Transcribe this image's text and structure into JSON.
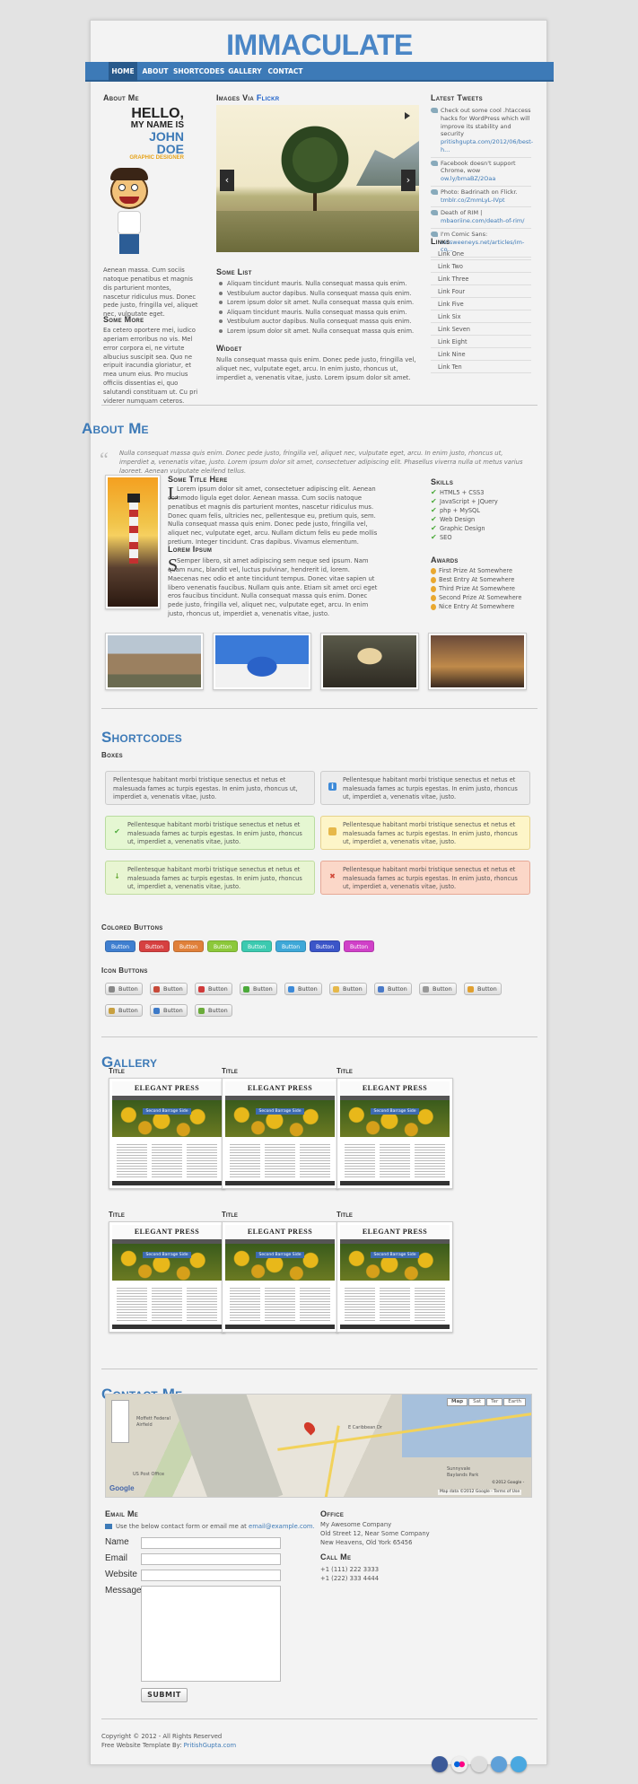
{
  "site": {
    "logo": "IMMACULATE"
  },
  "nav": {
    "items": [
      "HOME",
      "ABOUT",
      "SHORTCODES",
      "GALLERY",
      "CONTACT"
    ]
  },
  "about_widget": {
    "title": "About Me",
    "badge_hello": "HELLO,",
    "badge_my_name": "MY NAME IS",
    "badge_name": "JOHN DOE",
    "badge_role": "GRAPHIC DESIGNER",
    "text1": "Aenean massa. Cum sociis natoque penatibus et magnis dis parturient montes, nascetur ridiculus mus. Donec pede justo, fringilla vel, aliquet nec, vulputate eget.",
    "more_title": "Some More",
    "text2": "Ea cetero oportere mei, iudico aperiam erroribus no vis. Mel error corpora ei, ne virtute albucius suscipit sea. Quo ne eripuit iracundia gloriatur, et mea unum eius. Pro mucius officiis dissentias ei, quo salutandi constituam ut. Cu pri viderer numquam ceteros."
  },
  "flickr": {
    "title_prefix": "Images Via ",
    "title_brand": "Flickr",
    "prev_icon": "chevron-left-icon",
    "next_icon": "chevron-right-icon"
  },
  "some_list": {
    "title": "Some List",
    "items": [
      "Aliquam tincidunt mauris. Nulla consequat massa quis enim.",
      "Vestibulum auctor dapibus. Nulla consequat massa quis enim.",
      "Lorem ipsum dolor sit amet. Nulla consequat massa quis enim.",
      "Aliquam tincidunt mauris. Nulla consequat massa quis enim.",
      "Vestibulum auctor dapibus. Nulla consequat massa quis enim.",
      "Lorem ipsum dolor sit amet. Nulla consequat massa quis enim."
    ]
  },
  "widget": {
    "title": "Widget",
    "text": "Nulla consequat massa quis enim. Donec pede justo, fringilla vel, aliquet nec, vulputate eget, arcu. In enim justo, rhoncus ut, imperdiet a, venenatis vitae, justo. Lorem ipsum dolor sit amet."
  },
  "tweets": {
    "title": "Latest Tweets",
    "items": [
      {
        "text": "Check out some cool .htaccess hacks for WordPress which will improve its stability and security",
        "link": "pritishgupta.com/2012/06/best-h..."
      },
      {
        "text": "Facebook doesn't support Chrome, wow",
        "link": "ow.ly/bmaBZ/2Oaa"
      },
      {
        "text": "Photo: Badrinath on Flickr.",
        "link": "tmblr.co/ZmmLyL-IVpt"
      },
      {
        "text": "Death of RIM |",
        "link": "mbaoriine.com/death-of-rim/"
      },
      {
        "text": "I'm Comic Sans:",
        "link": "mcsweeneys.net/articles/im-co..."
      }
    ]
  },
  "links": {
    "title": "Links",
    "items": [
      "Link One",
      "Link Two",
      "Link Three",
      "Link Four",
      "Link Five",
      "Link Six",
      "Link Seven",
      "Link Eight",
      "Link Nine",
      "Link Ten"
    ]
  },
  "about_section": {
    "title": "About Me",
    "quote": "Nulla consequat massa quis enim. Donec pede justo, fringilla vel, aliquet nec, vulputate eget, arcu. In enim justo, rhoncus ut, imperdiet a, venenatis vitae, justo. Lorem ipsum dolor sit amet, consectetuer adipiscing elit. Phasellus viverra nulla ut metus varius laoreet. Aenean vulputate eleifend tellus.",
    "heading1": "Some Title Here",
    "para1": "Lorem ipsum dolor sit amet, consectetuer adipiscing elit. Aenean commodo ligula eget dolor. Aenean massa. Cum sociis natoque penatibus et magnis dis parturient montes, nascetur ridiculus mus. Donec quam felis, ultricies nec, pellentesque eu, pretium quis, sem. Nulla consequat massa quis enim. Donec pede justo, fringilla vel, aliquet nec, vulputate eget, arcu. Nullam dictum felis eu pede mollis pretium. Integer tincidunt. Cras dapibus. Vivamus elementum.",
    "heading2": "Lorem Ipsum",
    "para2": "Semper libero, sit amet adipiscing sem neque sed ipsum. Nam quam nunc, blandit vel, luctus pulvinar, hendrerit id, lorem. Maecenas nec odio et ante tincidunt tempus. Donec vitae sapien ut libero venenatis faucibus. Nullam quis ante. Etiam sit amet orci eget eros faucibus tincidunt. Nulla consequat massa quis enim. Donec pede justo, fringilla vel, aliquet nec, vulputate eget, arcu. In enim justo, rhoncus ut, imperdiet a, venenatis vitae, justo.",
    "skills_title": "Skills",
    "skills": [
      "HTML5 + CSS3",
      "JavaScript + JQuery",
      "php + MySQL",
      "Web Design",
      "Graphic Design",
      "SEO"
    ],
    "awards_title": "Awards",
    "awards": [
      "First Prize At Somewhere",
      "Best Entry At Somewhere",
      "Third Prize At Somewhere",
      "Second Prize At Somewhere",
      "Nice Entry At Somewhere"
    ]
  },
  "shortcodes": {
    "title": "Shortcodes",
    "boxes_title": "Boxes",
    "box_text": "Pellentesque habitant morbi tristique senectus et netus et malesuada fames ac turpis egestas. In enim justo, rhoncus ut, imperdiet a, venenatis vitae, justo.",
    "colored_title": "Colored Buttons",
    "button_label": "Button",
    "colors": [
      "#3f7fd0",
      "#d64040",
      "#e0803a",
      "#8cc83a",
      "#3ccab0",
      "#3ea8d8",
      "#3b55c8",
      "#d040c8"
    ],
    "icon_title": "Icon Buttons"
  },
  "gallery": {
    "title": "Gallery",
    "item_title": "Title",
    "thumb_header": "ELEGANT PRESS",
    "thumb_ribbon": "Second Barrage Side"
  },
  "contact": {
    "title": "Contact Me",
    "map_buttons": [
      "Map",
      "Sat",
      "Ter",
      "Earth"
    ],
    "map_google": "Google",
    "map_copyright": "©2012 Google -",
    "map_footer": "Map data ©2012 Google - Terms of Use",
    "map_labels": [
      "Moffett Federal Airfield",
      "Sunnyvale Baylands Park",
      "E Caribbean Dr",
      "US Post Office"
    ],
    "email_title": "Email Me",
    "email_text": "Use the below contact form or email me at",
    "email_link": "email@example.com.",
    "fields": [
      "Name",
      "Email",
      "Website",
      "Message"
    ],
    "submit": "SUBMIT",
    "office_title": "Office",
    "office_lines": [
      "My Awesome Company",
      "Old Street 12, Near Some Company",
      "New Heavens, Old York 65456"
    ],
    "call_title": "Call Me",
    "phones": [
      "+1 (111) 222 3333",
      "+1 (222) 333 4444"
    ]
  },
  "footer": {
    "copyright": "Copyright © 2012 - All Rights Reserved",
    "credit_prefix": "Free Website Template By:",
    "credit_link": "PritishGupta.com"
  }
}
